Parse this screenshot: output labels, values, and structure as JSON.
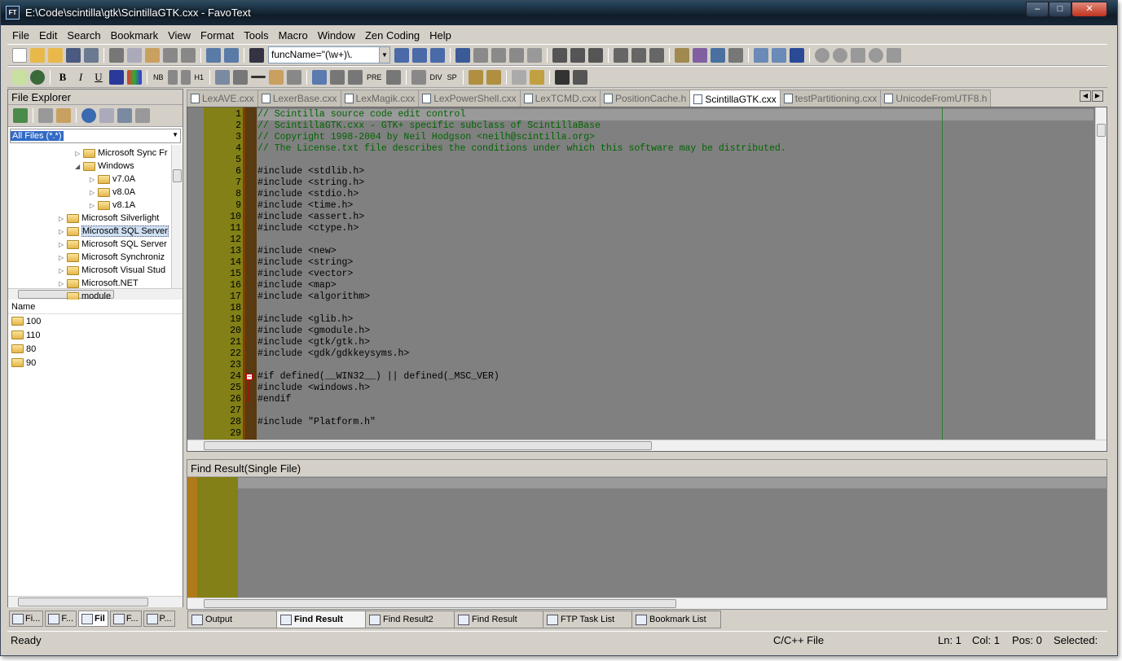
{
  "window": {
    "title": "E:\\Code\\scintilla\\gtk\\ScintillaGTK.cxx - FavoText",
    "app_icon": "FT",
    "minimize": "–",
    "maximize": "□",
    "close": "✕"
  },
  "menu": [
    "File",
    "Edit",
    "Search",
    "Bookmark",
    "View",
    "Format",
    "Tools",
    "Macro",
    "Window",
    "Zen Coding",
    "Help"
  ],
  "toolbar": {
    "search_combo": "funcName=\"(\\w+)\\."
  },
  "format_toolbar": {
    "bold": "B",
    "italic": "I",
    "underline": "U",
    "nb": "NB",
    "h1": "H1",
    "pre": "PRE",
    "div": "DIV",
    "sp": "SP"
  },
  "file_explorer": {
    "title": "File Explorer",
    "filter": "All Files (*.*)",
    "tree": [
      {
        "label": "Microsoft Sync Fr",
        "depth": 2,
        "expander": "▷",
        "highlight": false
      },
      {
        "label": "Windows",
        "depth": 2,
        "expander": "◢",
        "highlight": false
      },
      {
        "label": "v7.0A",
        "depth": 3,
        "expander": "▷",
        "highlight": false
      },
      {
        "label": "v8.0A",
        "depth": 3,
        "expander": "▷",
        "highlight": false
      },
      {
        "label": "v8.1A",
        "depth": 3,
        "expander": "▷",
        "highlight": false
      },
      {
        "label": "Microsoft Silverlight",
        "depth": 1,
        "expander": "▷",
        "highlight": false
      },
      {
        "label": "Microsoft SQL Server",
        "depth": 1,
        "expander": "▷",
        "highlight": true
      },
      {
        "label": "Microsoft SQL Server",
        "depth": 1,
        "expander": "▷",
        "highlight": false
      },
      {
        "label": "Microsoft Synchroniz",
        "depth": 1,
        "expander": "▷",
        "highlight": false
      },
      {
        "label": "Microsoft Visual Stud",
        "depth": 1,
        "expander": "▷",
        "highlight": false
      },
      {
        "label": "Microsoft.NET",
        "depth": 1,
        "expander": "▷",
        "highlight": false
      },
      {
        "label": "module",
        "depth": 1,
        "expander": "",
        "highlight": false
      }
    ],
    "list_header": "Name",
    "list_items": [
      "100",
      "110",
      "80",
      "90"
    ]
  },
  "panel_tabs": [
    "Fi...",
    "F...",
    "Fil",
    "F...",
    "P..."
  ],
  "editor_tabs": [
    {
      "label": "LexAVE.cxx",
      "active": false
    },
    {
      "label": "LexerBase.cxx",
      "active": false
    },
    {
      "label": "LexMagik.cxx",
      "active": false
    },
    {
      "label": "LexPowerShell.cxx",
      "active": false
    },
    {
      "label": "LexTCMD.cxx",
      "active": false
    },
    {
      "label": "PositionCache.h",
      "active": false
    },
    {
      "label": "ScintillaGTK.cxx",
      "active": true
    },
    {
      "label": "testPartitioning.cxx",
      "active": false
    },
    {
      "label": "UnicodeFromUTF8.h",
      "active": false
    }
  ],
  "code_lines": [
    {
      "n": "1",
      "text": "// Scintilla source code edit control",
      "comment": true
    },
    {
      "n": "2",
      "text": "// ScintillaGTK.cxx - GTK+ specific subclass of ScintillaBase",
      "comment": true
    },
    {
      "n": "3",
      "text": "// Copyright 1998-2004 by Neil Hodgson <neilh@scintilla.org>",
      "comment": true
    },
    {
      "n": "4",
      "text": "// The License.txt file describes the conditions under which this software may be distributed.",
      "comment": true
    },
    {
      "n": "5",
      "text": "",
      "comment": false
    },
    {
      "n": "6",
      "text": "#include <stdlib.h>",
      "comment": false
    },
    {
      "n": "7",
      "text": "#include <string.h>",
      "comment": false
    },
    {
      "n": "8",
      "text": "#include <stdio.h>",
      "comment": false
    },
    {
      "n": "9",
      "text": "#include <time.h>",
      "comment": false
    },
    {
      "n": "10",
      "text": "#include <assert.h>",
      "comment": false
    },
    {
      "n": "11",
      "text": "#include <ctype.h>",
      "comment": false
    },
    {
      "n": "12",
      "text": "",
      "comment": false
    },
    {
      "n": "13",
      "text": "#include <new>",
      "comment": false
    },
    {
      "n": "14",
      "text": "#include <string>",
      "comment": false
    },
    {
      "n": "15",
      "text": "#include <vector>",
      "comment": false
    },
    {
      "n": "16",
      "text": "#include <map>",
      "comment": false
    },
    {
      "n": "17",
      "text": "#include <algorithm>",
      "comment": false
    },
    {
      "n": "18",
      "text": "",
      "comment": false
    },
    {
      "n": "19",
      "text": "#include <glib.h>",
      "comment": false
    },
    {
      "n": "20",
      "text": "#include <gmodule.h>",
      "comment": false
    },
    {
      "n": "21",
      "text": "#include <gtk/gtk.h>",
      "comment": false
    },
    {
      "n": "22",
      "text": "#include <gdk/gdkkeysyms.h>",
      "comment": false
    },
    {
      "n": "23",
      "text": "",
      "comment": false
    },
    {
      "n": "24",
      "text": "#if defined(__WIN32__) || defined(_MSC_VER)",
      "comment": false
    },
    {
      "n": "25",
      "text": "#include <windows.h>",
      "comment": false
    },
    {
      "n": "26",
      "text": "#endif",
      "comment": false
    },
    {
      "n": "27",
      "text": "",
      "comment": false
    },
    {
      "n": "28",
      "text": "#include \"Platform.h\"",
      "comment": false
    },
    {
      "n": "29",
      "text": "",
      "comment": false
    }
  ],
  "find_panel": {
    "title": "Find Result(Single File)"
  },
  "bottom_tabs": [
    {
      "label": "Output",
      "active": false
    },
    {
      "label": "Find Result",
      "active": true
    },
    {
      "label": "Find Result2",
      "active": false
    },
    {
      "label": "Find Result",
      "active": false
    },
    {
      "label": "FTP Task List",
      "active": false
    },
    {
      "label": "Bookmark List",
      "active": false
    }
  ],
  "status": {
    "ready": "Ready",
    "lang": "C/C++ File",
    "ln": "Ln: 1",
    "col": "Col: 1",
    "pos": "Pos: 0",
    "selected": "Selected:"
  },
  "colors": {
    "gutter": "#828016",
    "editor_bg": "#808080",
    "comment": "#006400"
  }
}
